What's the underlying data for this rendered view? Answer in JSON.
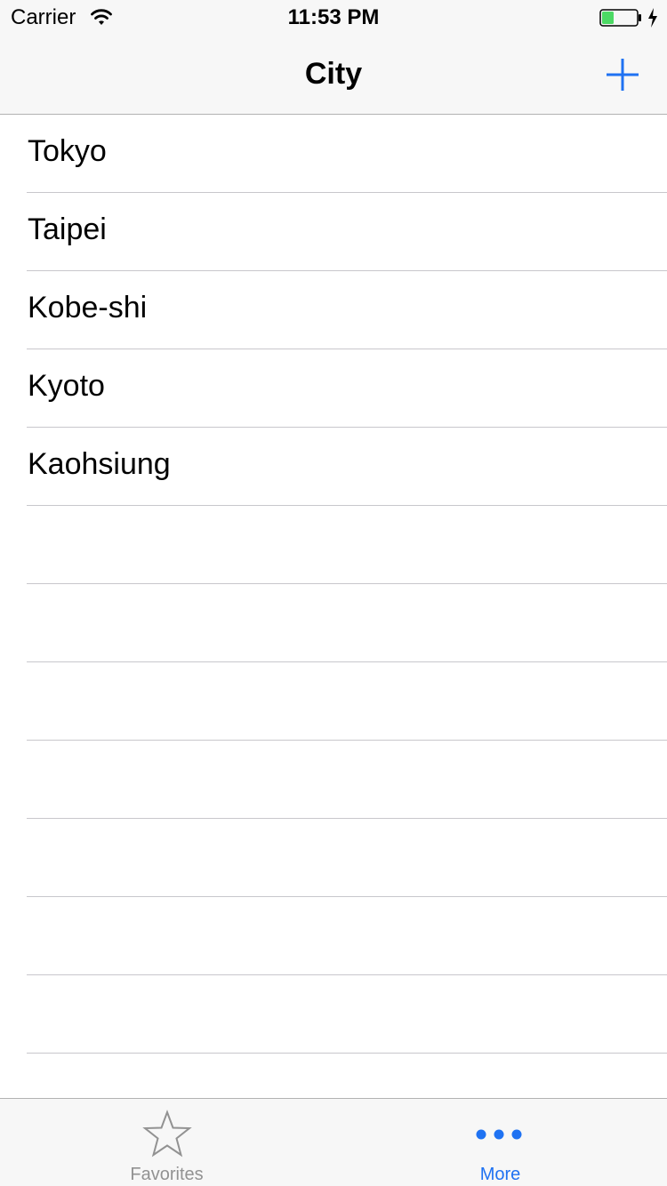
{
  "status_bar": {
    "carrier": "Carrier",
    "time": "11:53 PM",
    "wifi_icon": "wifi-icon",
    "battery_icon": "battery-icon",
    "battery_level": 0.35,
    "battery_color": "#4cd964",
    "charging_icon": "charging-bolt-icon"
  },
  "nav_bar": {
    "title": "City",
    "add_icon": "plus-icon"
  },
  "cities": [
    {
      "name": "Tokyo"
    },
    {
      "name": "Taipei"
    },
    {
      "name": "Kobe-shi"
    },
    {
      "name": "Kyoto"
    },
    {
      "name": "Kaohsiung"
    }
  ],
  "tab_bar": {
    "tabs": [
      {
        "label": "Favorites",
        "icon": "star-icon",
        "selected": false
      },
      {
        "label": "More",
        "icon": "more-dots-icon",
        "selected": true
      }
    ]
  },
  "colors": {
    "accent": "#1f72f2",
    "inactive": "#929292",
    "bar_background": "#f7f7f7",
    "separator": "#c8c7cc"
  }
}
